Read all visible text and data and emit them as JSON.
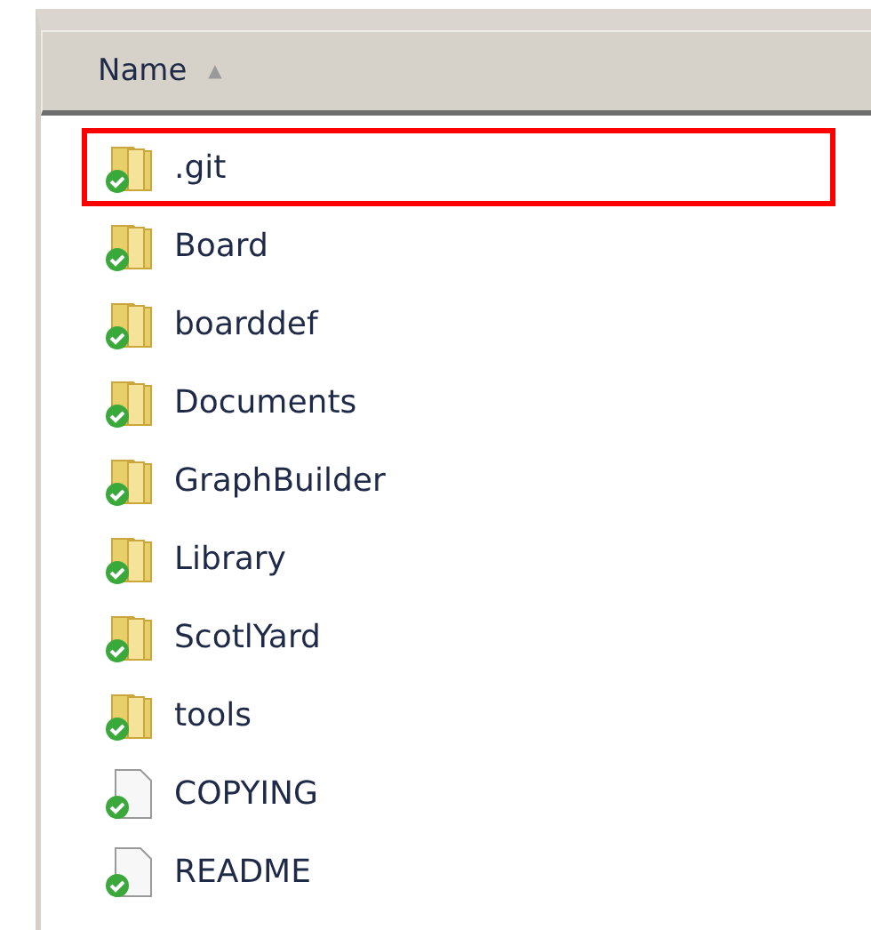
{
  "column_header": {
    "label": "Name",
    "sort_arrow": "▲"
  },
  "items": [
    {
      "name": ".git",
      "kind": "folder",
      "highlighted": true
    },
    {
      "name": "Board",
      "kind": "folder",
      "highlighted": false
    },
    {
      "name": "boarddef",
      "kind": "folder",
      "highlighted": false
    },
    {
      "name": "Documents",
      "kind": "folder",
      "highlighted": false
    },
    {
      "name": "GraphBuilder",
      "kind": "folder",
      "highlighted": false
    },
    {
      "name": "Library",
      "kind": "folder",
      "highlighted": false
    },
    {
      "name": "ScotlYard",
      "kind": "folder",
      "highlighted": false
    },
    {
      "name": "tools",
      "kind": "folder",
      "highlighted": false
    },
    {
      "name": "COPYING",
      "kind": "file",
      "highlighted": false
    },
    {
      "name": "README",
      "kind": "file",
      "highlighted": false
    }
  ]
}
